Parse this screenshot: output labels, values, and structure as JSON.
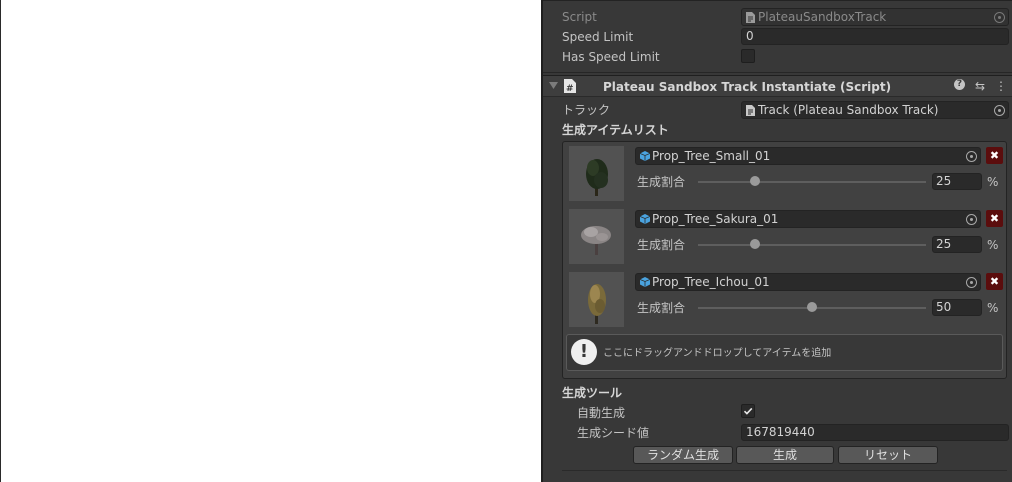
{
  "top_component": {
    "script_label": "Script",
    "script_value": "PlateauSandboxTrack",
    "speed_limit_label": "Speed Limit",
    "speed_limit_value": "0",
    "has_speed_limit_label": "Has Speed Limit",
    "has_speed_limit_checked": false
  },
  "component": {
    "title": "Plateau Sandbox Track Instantiate (Script)",
    "help_glyph": "?",
    "settings_glyph": "⇆",
    "menu_glyph": "⋮",
    "track_label": "トラック",
    "track_value": "Track (Plateau Sandbox Track)",
    "list_title": "生成アイテムリスト",
    "items": [
      {
        "name": "Prop_Tree_Small_01",
        "ratio_label": "生成割合",
        "ratio": "25",
        "unit": "%",
        "fraction": 0.25,
        "icon": "tree-dark-green-icon"
      },
      {
        "name": "Prop_Tree_Sakura_01",
        "ratio_label": "生成割合",
        "ratio": "25",
        "unit": "%",
        "fraction": 0.25,
        "icon": "tree-sakura-icon"
      },
      {
        "name": "Prop_Tree_Ichou_01",
        "ratio_label": "生成割合",
        "ratio": "50",
        "unit": "%",
        "fraction": 0.5,
        "icon": "tree-ichou-icon"
      }
    ],
    "dropzone_text": "ここにドラッグアンドドロップしてアイテムを追加",
    "dropzone_icon": "!",
    "tools_title": "生成ツール",
    "auto_generate_label": "自動生成",
    "auto_generate_checked": true,
    "seed_label": "生成シード値",
    "seed_value": "167819440",
    "buttons": {
      "random": "ランダム生成",
      "generate": "生成",
      "reset": "リセット"
    }
  },
  "colors": {
    "panel_bg": "#383838",
    "remove_button": "#5b0d0d",
    "field_bg": "#2a2a2a"
  }
}
